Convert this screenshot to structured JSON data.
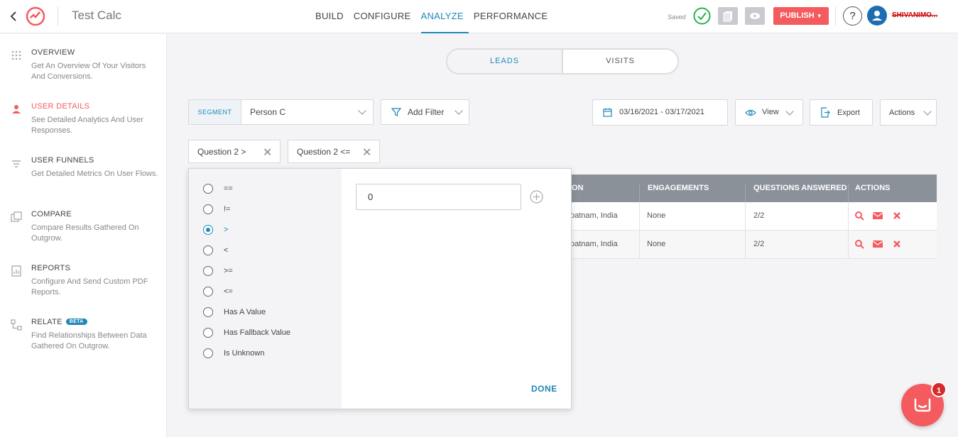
{
  "header": {
    "app_title": "Test Calc",
    "nav": [
      "BUILD",
      "CONFIGURE",
      "ANALYZE",
      "PERFORMANCE"
    ],
    "active_nav": "ANALYZE",
    "saved_label": "Saved",
    "publish_label": "PUBLISH",
    "help_label": "?",
    "username": "SHIVANIMO..."
  },
  "sidebar": {
    "items": [
      {
        "title": "OVERVIEW",
        "desc": "Get An Overview Of Your Visitors And Conversions."
      },
      {
        "title": "USER DETAILS",
        "desc": "See Detailed Analytics And User Responses."
      },
      {
        "title": "USER FUNNELS",
        "desc": "Get Detailed Metrics On User Flows."
      },
      {
        "title": "COMPARE",
        "desc": "Compare Results Gathered On Outgrow."
      },
      {
        "title": "REPORTS",
        "desc": "Configure And Send Custom PDF Reports."
      },
      {
        "title": "RELATE",
        "badge": "BETA",
        "desc": "Find Relationships Between Data Gathered On Outgrow."
      }
    ]
  },
  "toggle": {
    "leads": "LEADS",
    "visits": "VISITS"
  },
  "filters": {
    "segment_label": "SEGMENT",
    "segment_value": "Person C",
    "add_filter": "Add Filter",
    "date_range": "03/16/2021 - 03/17/2021",
    "view": "View",
    "export": "Export",
    "actions": "Actions",
    "chips": [
      "Question 2 >",
      "Question 2 <="
    ]
  },
  "table": {
    "headers": [
      "ON",
      "ENGAGEMENTS",
      "QUESTIONS ANSWERED",
      "ACTIONS"
    ],
    "rows": [
      {
        "location": "patnam, India",
        "engagements": "None",
        "answered": "2/2"
      },
      {
        "location": "patnam, India",
        "engagements": "None",
        "answered": "2/2"
      }
    ]
  },
  "popover": {
    "operators": [
      "==",
      "!=",
      ">",
      "<",
      ">=",
      "<=",
      "Has A Value",
      "Has Fallback Value",
      "Is Unknown"
    ],
    "selected_index": 2,
    "value": "0",
    "done_label": "DONE"
  },
  "chat": {
    "badge": "1"
  },
  "colors": {
    "accent": "#1e88b7",
    "brand": "#f45b5f"
  }
}
